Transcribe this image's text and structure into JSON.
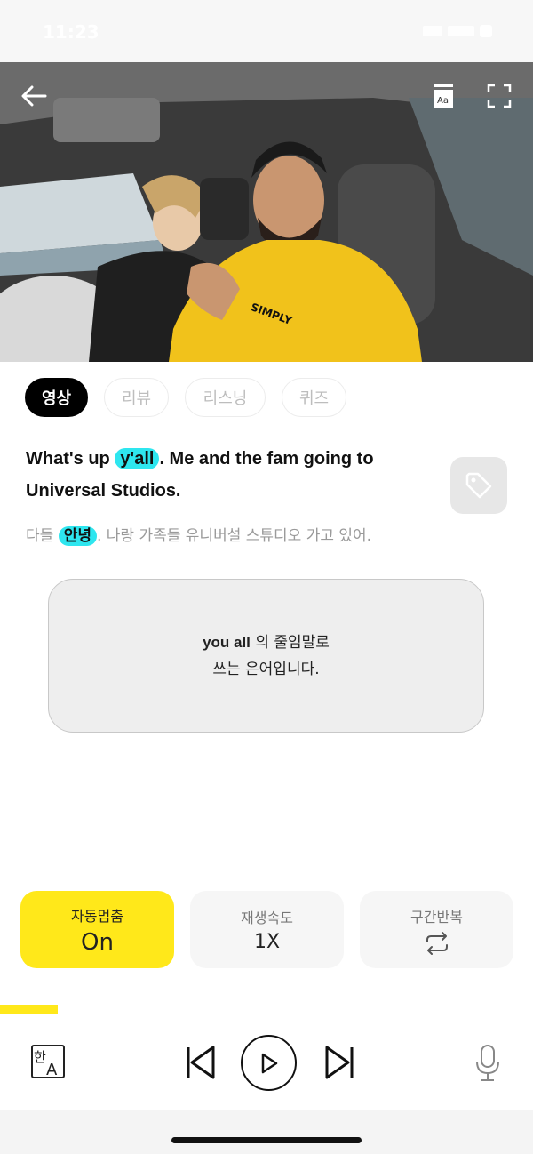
{
  "status_bar": {
    "time": "11:23"
  },
  "video": {
    "back_icon": "arrow-left-icon",
    "subtitle_icon": "subtitle-aa-icon",
    "fullscreen_icon": "fullscreen-icon"
  },
  "tabs": [
    {
      "label": "영상",
      "active": true
    },
    {
      "label": "리뷰",
      "active": false
    },
    {
      "label": "리스닝",
      "active": false
    },
    {
      "label": "퀴즈",
      "active": false
    }
  ],
  "sentence": {
    "before": "What's up ",
    "highlight": "y'all",
    "after": ". Me and the fam going to Universal Studios."
  },
  "translation": {
    "before": "다들 ",
    "highlight": "안녕",
    "after": ". 나랑 가족들 유니버설 스튜디오 가고 있어."
  },
  "note": {
    "term": "you all",
    "line1_rest": " 의 줄임말로",
    "line2": "쓰는 은어입니다."
  },
  "controls": [
    {
      "label": "자동멈춤",
      "value": "On",
      "active": true
    },
    {
      "label": "재생속도",
      "value": "1X",
      "active": false
    },
    {
      "label": "구간반복",
      "icon": "repeat-icon",
      "active": false
    }
  ],
  "progress": {
    "fraction": 0.108
  },
  "player": {
    "translate_icon": "korean-english-toggle-icon",
    "prev_icon": "skip-previous-icon",
    "play_icon": "play-icon",
    "next_icon": "skip-next-icon",
    "mic_icon": "microphone-icon"
  },
  "colors": {
    "accent_yellow": "#ffe81a",
    "highlight_cyan": "#2ee6ef"
  }
}
